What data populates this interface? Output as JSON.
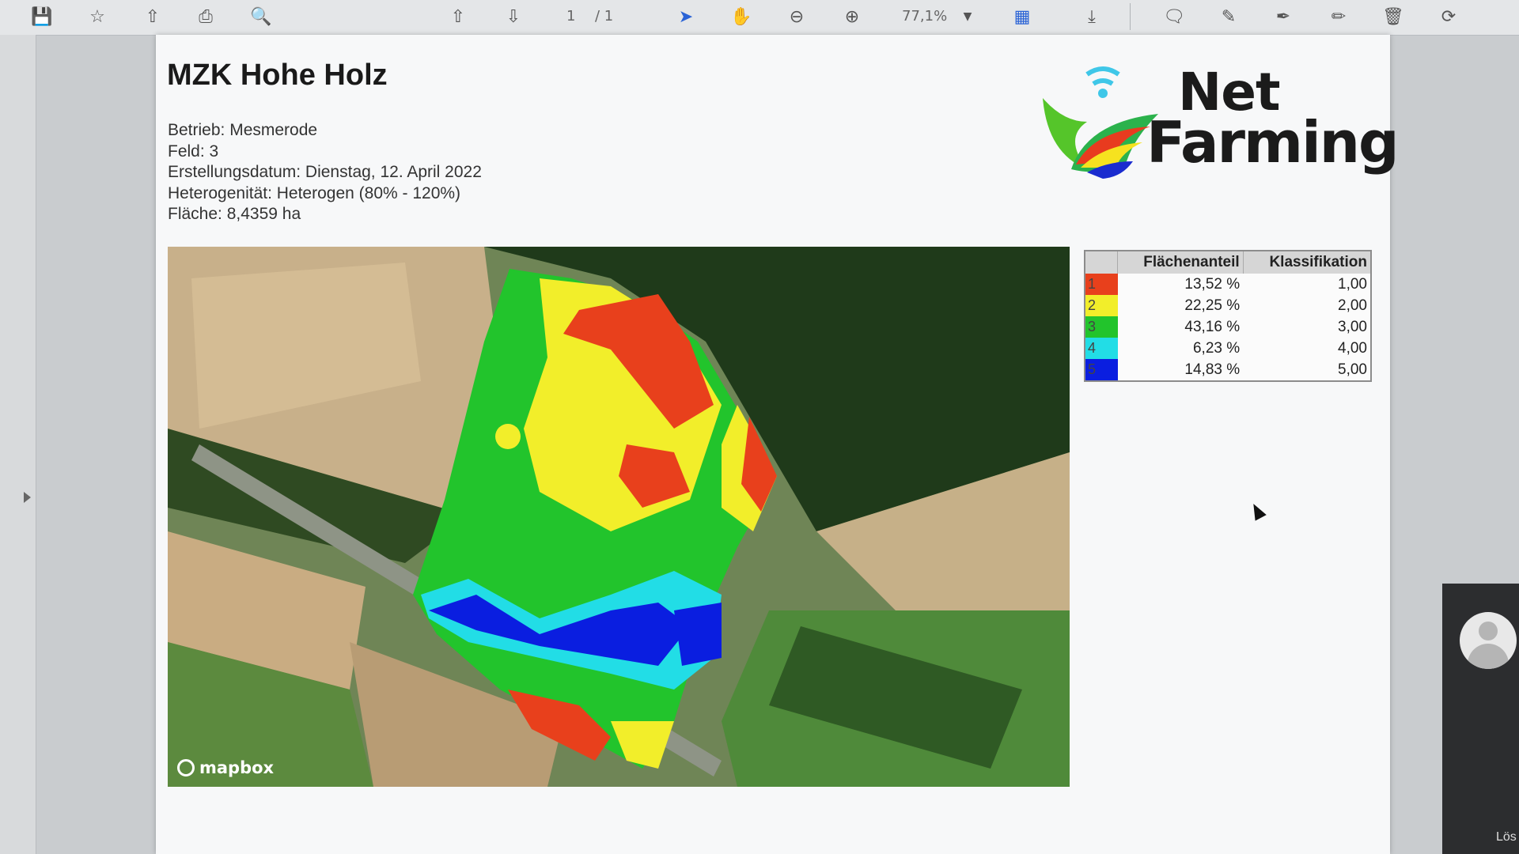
{
  "toolbar": {
    "page_current": "1",
    "page_total": "/ 1",
    "zoom": "77,1%",
    "icons": [
      "save-icon",
      "bookmark-star-icon",
      "upload-icon",
      "print-icon",
      "zoom-search-icon",
      "page-up-icon",
      "page-down-icon",
      "select-cursor-icon",
      "hand-tool-icon",
      "zoom-out-icon",
      "zoom-in-icon",
      "fit-page-icon",
      "download-icon",
      "comment-icon",
      "highlight-pen-icon",
      "sign-icon",
      "edit-icon",
      "delete-icon",
      "rotate-icon"
    ]
  },
  "document": {
    "title": "MZK Hohe Holz",
    "meta": [
      "Betrieb: Mesmerode",
      "Feld: 3",
      "Erstellungsdatum: Dienstag, 12. April 2022",
      "Heterogenität: Heterogen (80% - 120%)",
      "Fläche: 8,4359 ha"
    ],
    "logo": {
      "line1": "Net",
      "line2": "Farming"
    },
    "map": {
      "attribution": "mapbox"
    }
  },
  "legend": {
    "headers": {
      "share": "Flächenanteil",
      "class": "Klassifikation"
    },
    "rows": [
      {
        "id": "1",
        "color": "#e8401c",
        "share": "13,52 %",
        "class": "1,00"
      },
      {
        "id": "2",
        "color": "#f2ee2a",
        "share": "22,25 %",
        "class": "2,00"
      },
      {
        "id": "3",
        "color": "#22c42c",
        "share": "43,16 %",
        "class": "3,00"
      },
      {
        "id": "4",
        "color": "#22dde6",
        "share": "6,23 %",
        "class": "4,00"
      },
      {
        "id": "5",
        "color": "#0a1ee0",
        "share": "14,83 %",
        "class": "5,00"
      }
    ]
  },
  "video": {
    "label": "Lös"
  }
}
